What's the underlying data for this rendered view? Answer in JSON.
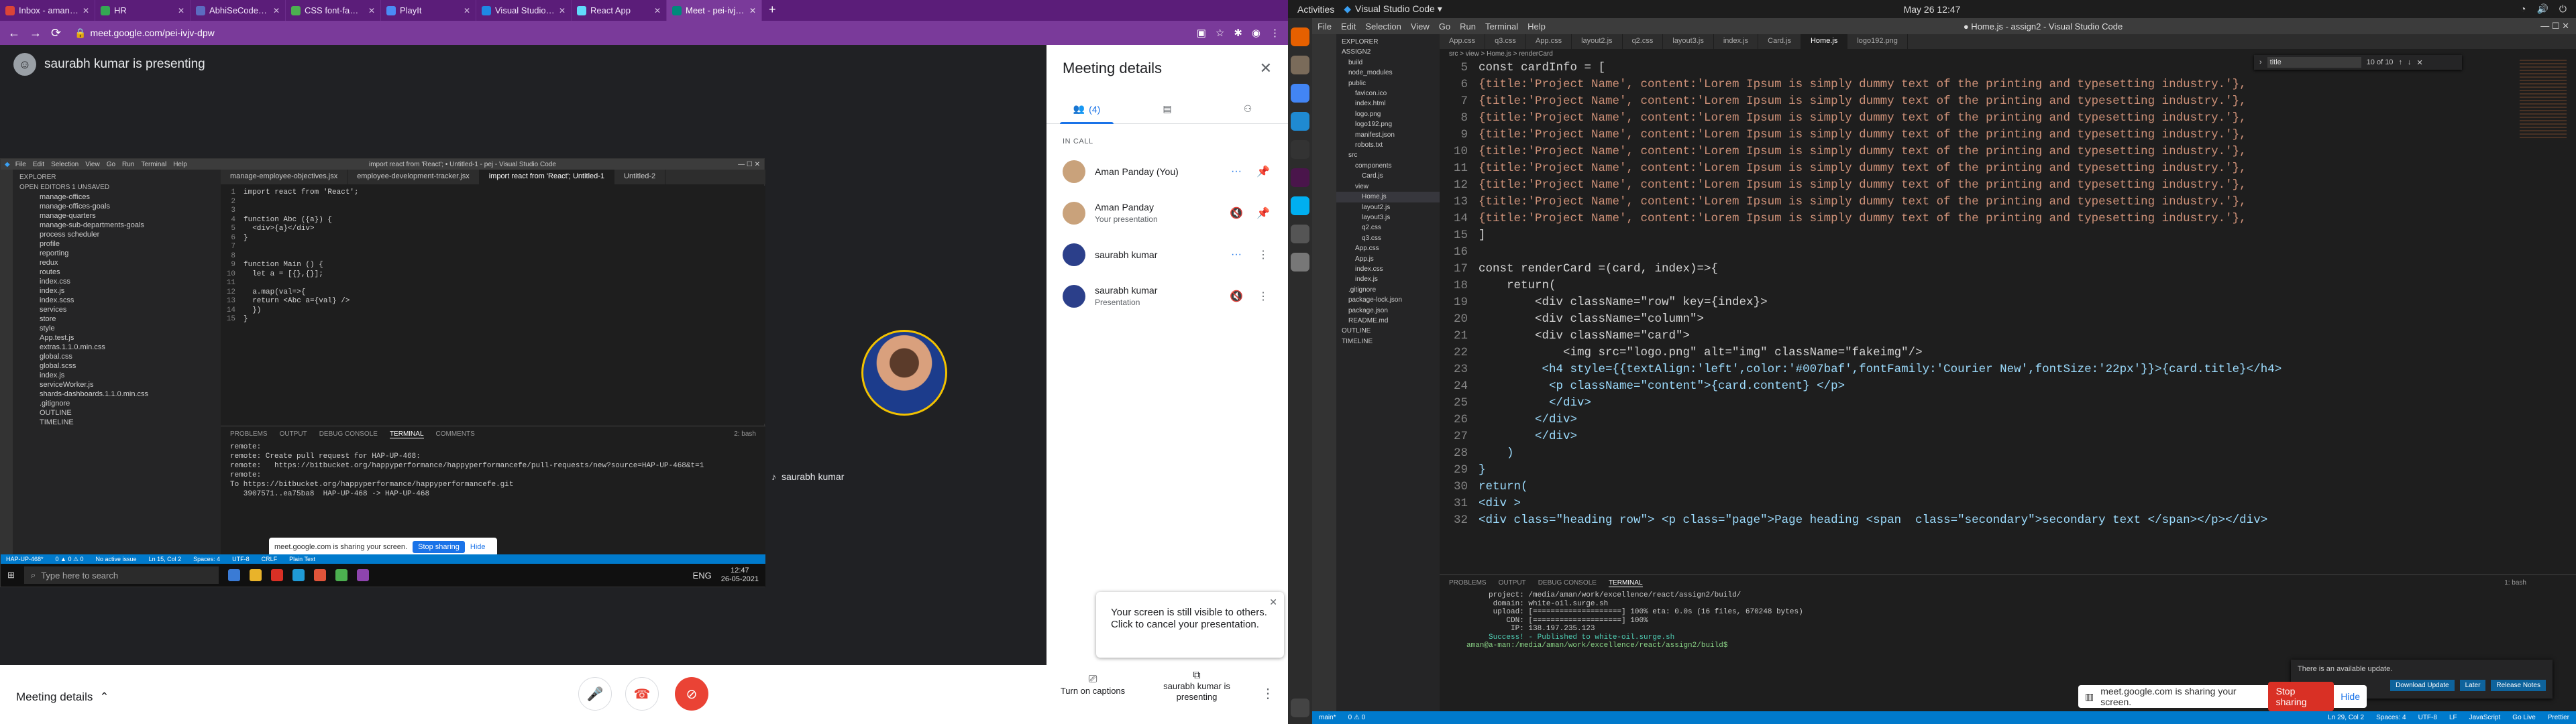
{
  "browser": {
    "tabs": [
      {
        "label": "Inbox - amanp@excelle",
        "color": "#db4437"
      },
      {
        "label": "HR",
        "color": "#34a853"
      },
      {
        "label": "AbhiSeCode (Abhishek",
        "color": "#5c6bc0"
      },
      {
        "label": "CSS font-family prope",
        "color": "#4caf50"
      },
      {
        "label": "PlayIt",
        "color": "#4b8bf5"
      },
      {
        "label": "Visual Studio Code -",
        "color": "#1e88e5"
      },
      {
        "label": "React App",
        "color": "#61dafb"
      },
      {
        "label": "Meet - pei-ivjv-dpw",
        "color": "#00897b"
      }
    ],
    "url": "meet.google.com/pei-ivjv-dpw"
  },
  "meet": {
    "presenting_banner": "saurabh kumar is presenting",
    "participant_tile_name": "saurabh kumar",
    "panel": {
      "title": "Meeting details",
      "people_tab_count": "(4)",
      "in_call_label": "IN CALL",
      "participants": [
        {
          "name": "Aman Panday (You)",
          "sub": "",
          "avatar_color": "#c9a27b"
        },
        {
          "name": "Aman Panday",
          "sub": "Your presentation",
          "avatar_color": "#c9a27b"
        },
        {
          "name": "saurabh kumar",
          "sub": "",
          "avatar_color": "#2b3f8a"
        },
        {
          "name": "saurabh kumar",
          "sub": "Presentation",
          "avatar_color": "#2b3f8a"
        }
      ]
    },
    "bottom": {
      "meeting_details": "Meeting details",
      "captions": "Turn on captions",
      "presenting": "saurabh kumar is presenting"
    },
    "notice": "Your screen is still visible to others. Click to cancel your presentation."
  },
  "shared_screen": {
    "title": "import react from 'React'; • Untitled-1 - pej - Visual Studio Code",
    "menu": [
      "File",
      "Edit",
      "Selection",
      "View",
      "Go",
      "Run",
      "Terminal",
      "Help"
    ],
    "explorer_header": "EXPLORER",
    "open_editors": "OPEN EDITORS  1 UNSAVED",
    "tree": [
      "manage-offices",
      "manage-offices-goals",
      "manage-quarters",
      "manage-sub-departments-goals",
      "process scheduler",
      "profile",
      "reporting",
      "redux",
      "routes",
      "index.css",
      "index.js",
      "index.scss",
      "services",
      "store",
      "style",
      "App.test.js",
      "extras.1.1.0.min.css",
      "global.css",
      "global.scss",
      "index.js",
      "serviceWorker.js",
      "shards-dashboards.1.1.0.min.css",
      ".gitignore",
      "OUTLINE",
      "TIMELINE"
    ],
    "tabs": [
      "manage-employee-objectives.jsx",
      "employee-development-tracker.jsx",
      "import react from 'React'; Untitled-1",
      "Untitled-2"
    ],
    "code": [
      "import react from 'React';",
      "",
      "",
      "function Abc ({a}) {",
      "  <div>{a}</div>",
      "}",
      "",
      "",
      "function Main () {",
      "  let a = [{},{}];",
      "",
      "  a.map(val=>{",
      "  return <Abc a={val} />",
      "  })",
      "}"
    ],
    "terminal_tabs": [
      "PROBLEMS",
      "OUTPUT",
      "DEBUG CONSOLE",
      "TERMINAL",
      "COMMENTS"
    ],
    "terminal_select": "2: bash",
    "terminal_lines": [
      "remote:",
      "remote: Create pull request for HAP-UP-468:",
      "remote:   https://bitbucket.org/happyperformance/happyperformancefe/pull-requests/new?source=HAP-UP-468&t=1",
      "remote:",
      "To https://bitbucket.org/happyperformance/happyperformancefe.git",
      "   3907571..ea75ba8  HAP-UP-468 -> HAP-UP-468"
    ],
    "status_items": [
      "HAP-UP-468*",
      "0 ▲ 0 ⚠ 0",
      "No active issue",
      "Ln 15, Col 2",
      "Spaces: 4",
      "UTF-8",
      "CRLF",
      "Plain Text"
    ],
    "taskbar_search": "Type here to search",
    "taskbar_lang": "ENG",
    "taskbar_time": "12:47",
    "taskbar_date": "26-05-2021",
    "share_text": "meet.google.com is sharing your screen.",
    "share_stop": "Stop sharing",
    "share_hide": "Hide"
  },
  "desktop": {
    "activities": "Activities",
    "app_name": "Visual Studio Code ▾",
    "clock": "May 26  12:47",
    "window_title": "● Home.js - assign2 - Visual Studio Code",
    "menu": [
      "File",
      "Edit",
      "Selection",
      "View",
      "Go",
      "Run",
      "Terminal",
      "Help"
    ],
    "tabs": [
      "App.css",
      "q3.css",
      "App.css",
      "layout2.js",
      "q2.css",
      "layout3.js",
      "index.js",
      "Card.js",
      "Home.js",
      "logo192.png"
    ],
    "breadcrumb": "src > view > Home.js > renderCard",
    "explorer": [
      "EXPLORER",
      "ASSIGN2",
      "build",
      "node_modules",
      "public",
      "favicon.ico",
      "index.html",
      "logo.png",
      "logo192.png",
      "manifest.json",
      "robots.txt",
      "src",
      "components",
      "Card.js",
      "view",
      "Home.js",
      "layout2.js",
      "layout3.js",
      "q2.css",
      "q3.css",
      "App.css",
      "App.js",
      "index.css",
      "index.js",
      ".gitignore",
      "package-lock.json",
      "package.json",
      "README.md",
      "OUTLINE",
      "TIMELINE"
    ],
    "find_value": "title",
    "find_count": "10 of 10",
    "code": [
      {
        "n": "5",
        "t": "const cardInfo = ["
      },
      {
        "n": "6",
        "t": "{title:'Project Name', content:'Lorem Ipsum is simply dummy text of the printing and typesetting industry.'},"
      },
      {
        "n": "7",
        "t": "{title:'Project Name', content:'Lorem Ipsum is simply dummy text of the printing and typesetting industry.'},"
      },
      {
        "n": "8",
        "t": "{title:'Project Name', content:'Lorem Ipsum is simply dummy text of the printing and typesetting industry.'},"
      },
      {
        "n": "9",
        "t": "{title:'Project Name', content:'Lorem Ipsum is simply dummy text of the printing and typesetting industry.'},"
      },
      {
        "n": "10",
        "t": "{title:'Project Name', content:'Lorem Ipsum is simply dummy text of the printing and typesetting industry.'},"
      },
      {
        "n": "11",
        "t": "{title:'Project Name', content:'Lorem Ipsum is simply dummy text of the printing and typesetting industry.'},"
      },
      {
        "n": "12",
        "t": "{title:'Project Name', content:'Lorem Ipsum is simply dummy text of the printing and typesetting industry.'},"
      },
      {
        "n": "13",
        "t": "{title:'Project Name', content:'Lorem Ipsum is simply dummy text of the printing and typesetting industry.'},"
      },
      {
        "n": "14",
        "t": "{title:'Project Name', content:'Lorem Ipsum is simply dummy text of the printing and typesetting industry.'},"
      },
      {
        "n": "15",
        "t": "]"
      },
      {
        "n": "16",
        "t": ""
      },
      {
        "n": "17",
        "t": "const renderCard =(card, index)=>{"
      },
      {
        "n": "18",
        "t": "    return("
      },
      {
        "n": "19",
        "t": "        <div className=\"row\" key={index}>"
      },
      {
        "n": "20",
        "t": "        <div className=\"column\">"
      },
      {
        "n": "21",
        "t": "        <div className=\"card\">"
      },
      {
        "n": "22",
        "t": "            <img src=\"logo.png\" alt=\"img\" className=\"fakeimg\"/>"
      },
      {
        "n": "23",
        "t": "         <h4 style={{textAlign:'left',color:'#007baf',fontFamily:'Courier New',fontSize:'22px'}}>{card.title}</h4>"
      },
      {
        "n": "24",
        "t": "          <p className=\"content\">{card.content} </p>"
      },
      {
        "n": "25",
        "t": "          </div>"
      },
      {
        "n": "26",
        "t": "        </div>"
      },
      {
        "n": "27",
        "t": "        </div>"
      },
      {
        "n": "28",
        "t": "    )"
      },
      {
        "n": "29",
        "t": "}"
      },
      {
        "n": "30",
        "t": "return("
      },
      {
        "n": "31",
        "t": "<div >"
      },
      {
        "n": "32",
        "t": "<div class=\"heading row\"> <p class=\"page\">Page heading <span  class=\"secondary\">secondary text </span></p></div>"
      }
    ],
    "terminal_tabs": [
      "PROBLEMS",
      "OUTPUT",
      "DEBUG CONSOLE",
      "TERMINAL"
    ],
    "terminal_select": "1: bash",
    "terminal_lines": [
      "     project: /media/aman/work/excellence/react/assign2/build/",
      "      domain: white-oil.surge.sh",
      "      upload: [====================] 100% eta: 0.0s (16 files, 670248 bytes)",
      "         CDN: [====================] 100%",
      "          IP: 138.197.235.123",
      "",
      "     Success! - Published to white-oil.surge.sh",
      "",
      "aman@a-man:/media/aman/work/excellence/react/assign2/build$"
    ],
    "update_text": "There is an available update.",
    "update_buttons": [
      "Download Update",
      "Later",
      "Release Notes"
    ],
    "status_items": [
      "main*",
      "0 ⚠ 0",
      "Ln 29, Col 2",
      "Spaces: 4",
      "UTF-8",
      "LF",
      "JavaScript",
      "Go Live",
      "Prettier"
    ],
    "share_text": "meet.google.com is sharing your screen.",
    "share_stop": "Stop sharing",
    "share_hide": "Hide"
  }
}
